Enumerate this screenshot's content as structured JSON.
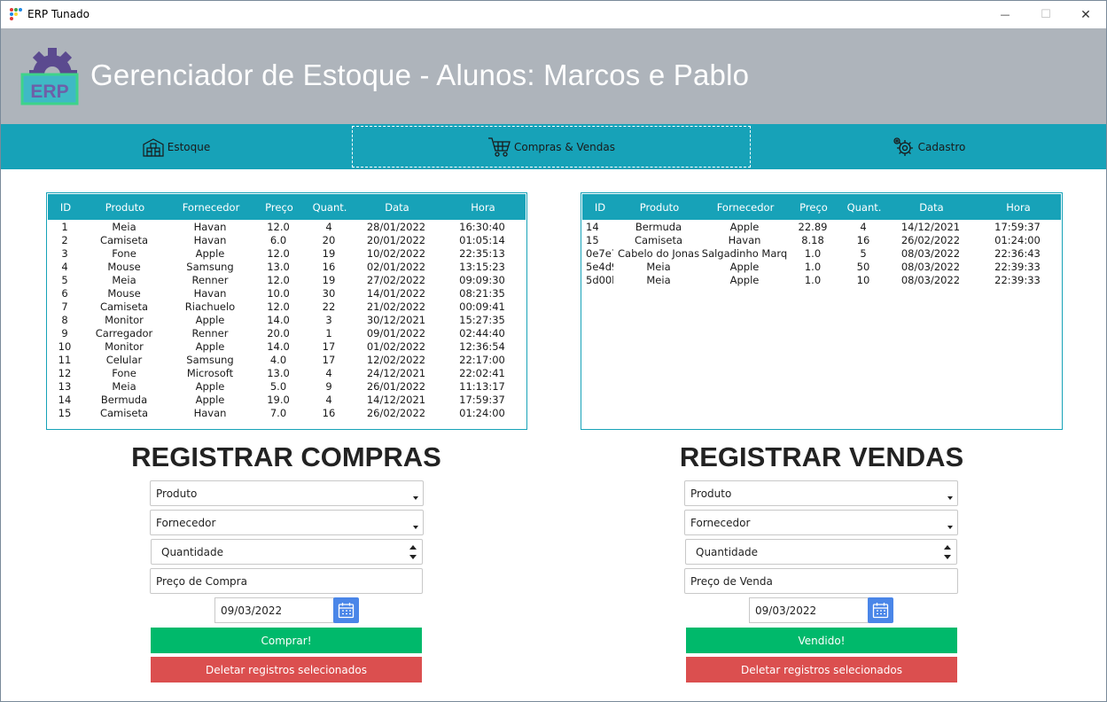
{
  "window": {
    "title": "ERP Tunado",
    "minimize": "—",
    "maximize": "☐",
    "close": "✕"
  },
  "header": {
    "logo_text": "ERP",
    "title": "Gerenciador de Estoque - Alunos: Marcos e Pablo"
  },
  "nav": {
    "items": [
      {
        "label": "Estoque",
        "icon": "warehouse-icon"
      },
      {
        "label": "Compras & Vendas",
        "icon": "shopping-cart-icon",
        "active": true
      },
      {
        "label": "Cadastro",
        "icon": "gear-icon"
      }
    ]
  },
  "colors": {
    "teal": "#17a2b8",
    "banner": "#aeb4bb",
    "green": "#00b96b",
    "red": "#db4f4f",
    "calendar": "#4a86e8"
  },
  "purchases_table": {
    "columns": [
      "ID",
      "Produto",
      "Fornecedor",
      "Preço",
      "Quant.",
      "Data",
      "Hora"
    ],
    "rows": [
      [
        "1",
        "Meia",
        "Havan",
        "12.0",
        "4",
        "28/01/2022",
        "16:30:40"
      ],
      [
        "2",
        "Camiseta",
        "Havan",
        "6.0",
        "20",
        "20/01/2022",
        "01:05:14"
      ],
      [
        "3",
        "Fone",
        "Apple",
        "12.0",
        "19",
        "10/02/2022",
        "22:35:13"
      ],
      [
        "4",
        "Mouse",
        "Samsung",
        "13.0",
        "16",
        "02/01/2022",
        "13:15:23"
      ],
      [
        "5",
        "Meia",
        "Renner",
        "12.0",
        "19",
        "27/02/2022",
        "09:09:30"
      ],
      [
        "6",
        "Mouse",
        "Havan",
        "10.0",
        "30",
        "14/01/2022",
        "08:21:35"
      ],
      [
        "7",
        "Camiseta",
        "Riachuelo",
        "12.0",
        "22",
        "21/02/2022",
        "00:09:41"
      ],
      [
        "8",
        "Monitor",
        "Apple",
        "14.0",
        "3",
        "30/12/2021",
        "15:27:35"
      ],
      [
        "9",
        "Carregador",
        "Renner",
        "20.0",
        "1",
        "09/01/2022",
        "02:44:40"
      ],
      [
        "10",
        "Monitor",
        "Apple",
        "14.0",
        "17",
        "01/02/2022",
        "12:36:54"
      ],
      [
        "11",
        "Celular",
        "Samsung",
        "4.0",
        "17",
        "12/02/2022",
        "22:17:00"
      ],
      [
        "12",
        "Fone",
        "Microsoft",
        "13.0",
        "4",
        "24/12/2021",
        "22:02:41"
      ],
      [
        "13",
        "Meia",
        "Apple",
        "5.0",
        "9",
        "26/01/2022",
        "11:13:17"
      ],
      [
        "14",
        "Bermuda",
        "Apple",
        "19.0",
        "4",
        "14/12/2021",
        "17:59:37"
      ],
      [
        "15",
        "Camiseta",
        "Havan",
        "7.0",
        "16",
        "26/02/2022",
        "01:24:00"
      ]
    ]
  },
  "sales_table": {
    "columns": [
      "ID",
      "Produto",
      "Fornecedor",
      "Preço",
      "Quant.",
      "Data",
      "Hora"
    ],
    "rows": [
      [
        "14",
        "Bermuda",
        "Apple",
        "22.89",
        "4",
        "14/12/2021",
        "17:59:37"
      ],
      [
        "15",
        "Camiseta",
        "Havan",
        "8.18",
        "16",
        "26/02/2022",
        "01:24:00"
      ],
      [
        "0e7e7",
        "Cabelo do Jonas",
        "Salgadinho Marq",
        "1.0",
        "5",
        "08/03/2022",
        "22:36:43"
      ],
      [
        "5e4d9",
        "Meia",
        "Apple",
        "1.0",
        "50",
        "08/03/2022",
        "22:39:33"
      ],
      [
        "5d00b",
        "Meia",
        "Apple",
        "1.0",
        "10",
        "08/03/2022",
        "22:39:33"
      ]
    ]
  },
  "purchase_form": {
    "title": "REGISTRAR COMPRAS",
    "product": "Produto",
    "supplier": "Fornecedor",
    "quantity": "Quantidade",
    "price": "Preço de Compra",
    "date": "09/03/2022",
    "submit": "Comprar!",
    "delete": "Deletar registros selecionados"
  },
  "sale_form": {
    "title": "REGISTRAR VENDAS",
    "product": "Produto",
    "supplier": "Fornecedor",
    "quantity": "Quantidade",
    "price": "Preço de Venda",
    "date": "09/03/2022",
    "submit": "Vendido!",
    "delete": "Deletar registros selecionados"
  }
}
